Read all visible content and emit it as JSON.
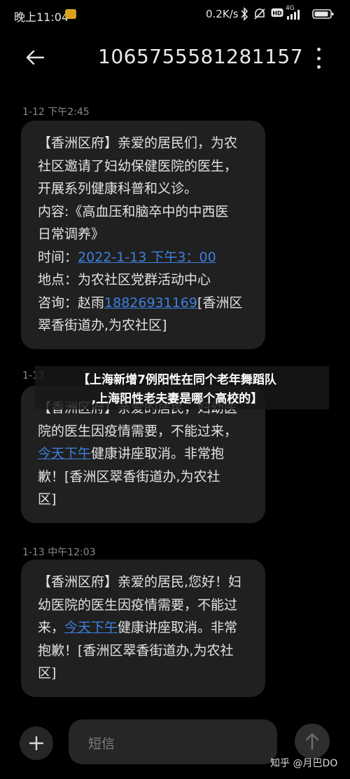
{
  "status_bar": {
    "time": "晚上11:04",
    "network_speed": "0.2K/s",
    "network_type": "4G",
    "icons": [
      "bluetooth-icon",
      "mute-icon",
      "hd-icon",
      "signal-icon",
      "battery-icon"
    ]
  },
  "header": {
    "contact_number": "1065755581281157"
  },
  "messages": [
    {
      "time": "1-12 下午2:45",
      "lines": [
        {
          "text": "【香洲区府】亲爱的居民们，为农"
        },
        {
          "text": "社区邀请了妇幼保健医院的医生，"
        },
        {
          "text": "开展系列健康科普和义诊。"
        },
        {
          "text": "内容:《高血压和脑卒中的中西医"
        },
        {
          "text": "日常调养》"
        },
        {
          "pre": "时间：",
          "link": "2022-1-13 下午3：00",
          "post": ""
        },
        {
          "text": "地点：为农社区党群活动中心"
        },
        {
          "pre": "咨询：赵雨",
          "link": "18826931169",
          "post": "[香洲区"
        },
        {
          "text": "翠香街道办,为农社区]"
        }
      ]
    },
    {
      "time": "1-13",
      "lines": [
        {
          "text": "【香洲区府】亲爱的居民，妇幼医"
        },
        {
          "text": "院的医生因疫情需要，不能过来，"
        },
        {
          "pre": "",
          "link": "今天下午",
          "post": "健康讲座取消。非常抱"
        },
        {
          "text": "歉！[香洲区翠香街道办,为农社"
        },
        {
          "text": "区]"
        }
      ]
    },
    {
      "time": "1-13 中午12:03",
      "lines": [
        {
          "text": "【香洲区府】亲爱的居民,您好！妇"
        },
        {
          "text": "幼医院的医生因疫情需要，不能过"
        },
        {
          "pre": "来，",
          "link": "今天下午",
          "post": "健康讲座取消。非常"
        },
        {
          "text": "抱歉！[香洲区翠香街道办,为农社"
        },
        {
          "text": "区]"
        }
      ]
    }
  ],
  "overlay": {
    "line1": "【上海新增7例阳性在同个老年舞蹈队",
    "line2": ",上海阳性老夫妻是哪个高校的】"
  },
  "composer": {
    "placeholder": "短信"
  },
  "watermark": "知乎 @月巴DO",
  "colors": {
    "background": "#000000",
    "bubble": "#202020",
    "link": "#3d7fe0",
    "timestamp": "#8a8a8a",
    "app_badge": "#d8a21f"
  }
}
